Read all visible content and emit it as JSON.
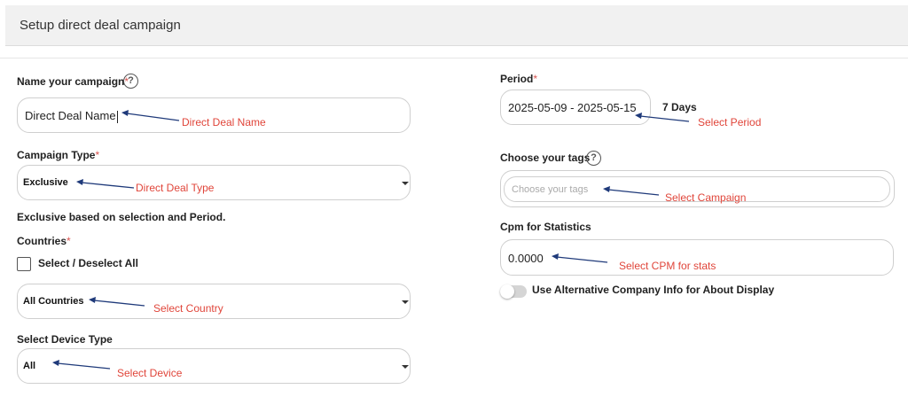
{
  "header": {
    "title": "Setup direct deal campaign"
  },
  "campaign_name": {
    "label": "Name your campaign",
    "required_mark": "*",
    "value": "Direct Deal Name",
    "annotation": "Direct Deal Name"
  },
  "campaign_type": {
    "label": "Campaign Type",
    "required_mark": "*",
    "selected": "Exclusive",
    "annotation": "Direct Deal Type",
    "note": "Exclusive based on selection and Period."
  },
  "countries": {
    "label": "Countries",
    "required_mark": "*",
    "select_all_label": "Select / Deselect All",
    "selected": "All Countries",
    "annotation": "Select Country"
  },
  "device_type": {
    "label": "Select Device Type",
    "selected": "All",
    "annotation": "Select Device"
  },
  "period": {
    "label": "Period",
    "required_mark": "*",
    "value": "2025-05-09 - 2025-05-15",
    "duration": "7 Days",
    "annotation": "Select Period"
  },
  "tags": {
    "label": "Choose your tags",
    "placeholder": "Choose your tags",
    "annotation": "Select Campaign"
  },
  "cpm": {
    "label": "Cpm for Statistics",
    "value": "0.0000",
    "annotation": "Select CPM for stats"
  },
  "alt_company": {
    "label": "Use Alternative Company Info for About Display",
    "enabled": false
  },
  "icons": {
    "help": "question-circle-icon",
    "dropdown": "caret-down-icon",
    "pointer": "arrow-left-icon"
  },
  "colors": {
    "annotation": "#e0453a",
    "arrow": "#1f3a7a",
    "required": "#d9534f"
  }
}
